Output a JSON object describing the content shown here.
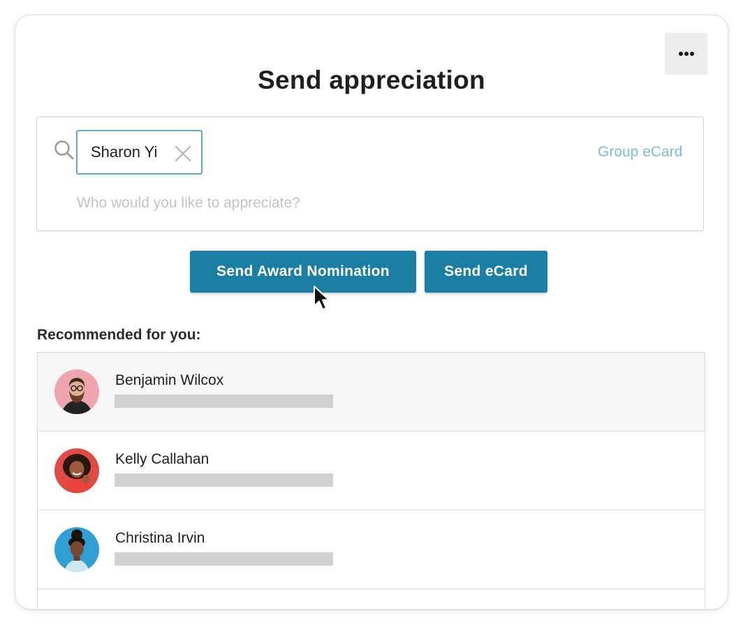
{
  "header": {
    "title": "Send appreciation",
    "more_icon": "more-horizontal-icon"
  },
  "search": {
    "icon": "search-icon",
    "chip_name": "Sharon Yi",
    "chip_remove_icon": "close-icon",
    "group_ecard_label": "Group eCard",
    "placeholder": "Who would you like to appreciate?"
  },
  "actions": {
    "award_label": "Send Award Nomination",
    "ecard_label": "Send eCard"
  },
  "recommended": {
    "heading": "Recommended for you:",
    "people": [
      {
        "name": "Benjamin Wilcox",
        "highlighted": true
      },
      {
        "name": "Kelly Callahan",
        "highlighted": false
      },
      {
        "name": "Christina Irvin",
        "highlighted": false
      }
    ]
  },
  "colors": {
    "primary_button": "#1b7ea5",
    "chip_border": "#5ea9c9",
    "link": "#7fbcd6",
    "placeholder": "#c2c2c2",
    "skeleton_bar": "#d0d0d0",
    "highlight_row": "#f6f6f6"
  }
}
